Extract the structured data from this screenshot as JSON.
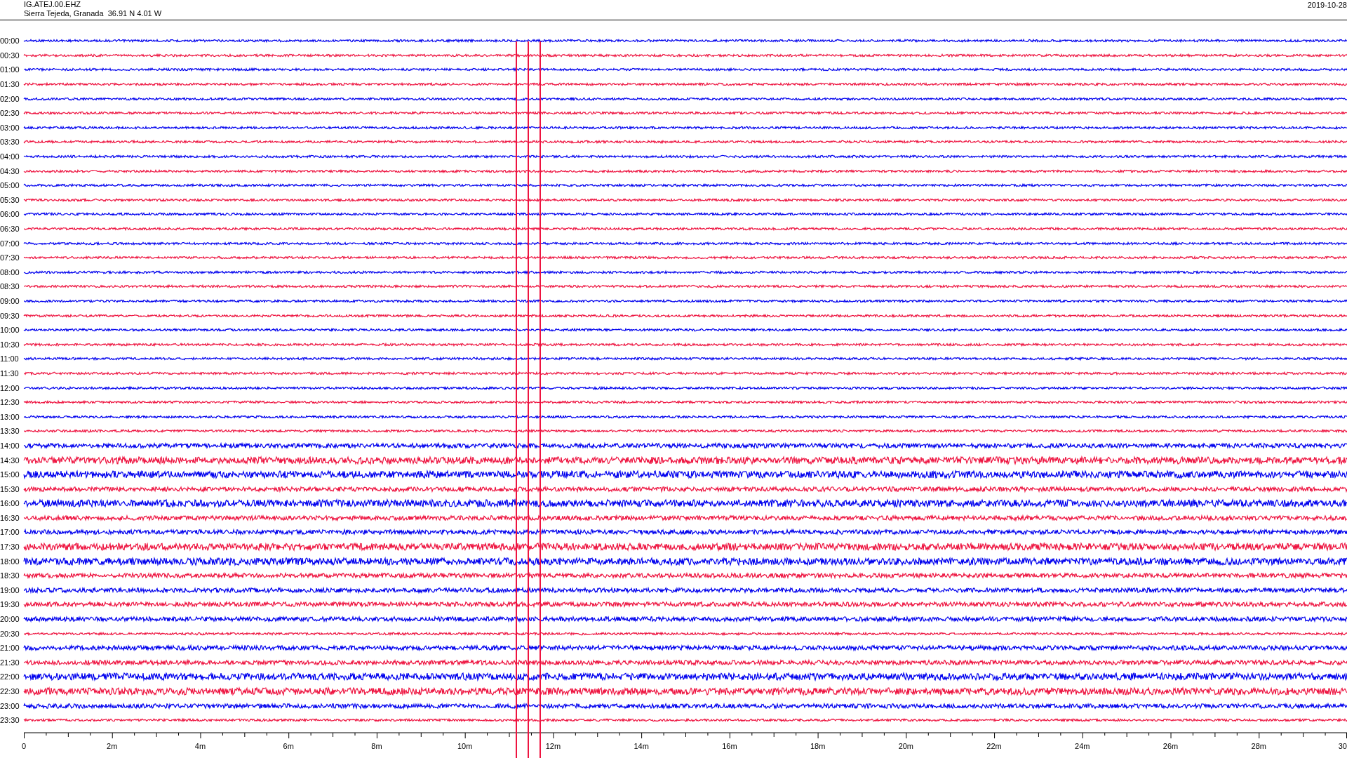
{
  "header": {
    "station": "IG.ATEJ.00.EHZ",
    "location": "Sierra Tejeda, Granada  36.91 N 4.01 W",
    "date": "2019-10-28"
  },
  "traces": [
    {
      "time": "00:00",
      "color": "#0000ee",
      "kind": "quiet"
    },
    {
      "time": "00:30",
      "color": "#ee1440",
      "kind": "quiet"
    },
    {
      "time": "01:00",
      "color": "#0000ee",
      "kind": "quiet"
    },
    {
      "time": "01:30",
      "color": "#ee1440",
      "kind": "quiet"
    },
    {
      "time": "02:00",
      "color": "#0000ee",
      "kind": "quiet"
    },
    {
      "time": "02:30",
      "color": "#ee1440",
      "kind": "quiet"
    },
    {
      "time": "03:00",
      "color": "#0000ee",
      "kind": "quiet"
    },
    {
      "time": "03:30",
      "color": "#ee1440",
      "kind": "quiet"
    },
    {
      "time": "04:00",
      "color": "#0000ee",
      "kind": "quiet"
    },
    {
      "time": "04:30",
      "color": "#ee1440",
      "kind": "quiet"
    },
    {
      "time": "05:00",
      "color": "#0000ee",
      "kind": "quiet"
    },
    {
      "time": "05:30",
      "color": "#ee1440",
      "kind": "quiet"
    },
    {
      "time": "06:00",
      "color": "#0000ee",
      "kind": "quiet"
    },
    {
      "time": "06:30",
      "color": "#ee1440",
      "kind": "quiet"
    },
    {
      "time": "07:00",
      "color": "#0000ee",
      "kind": "quiet"
    },
    {
      "time": "07:30",
      "color": "#ee1440",
      "kind": "quiet"
    },
    {
      "time": "08:00",
      "color": "#0000ee",
      "kind": "quiet"
    },
    {
      "time": "08:30",
      "color": "#ee1440",
      "kind": "quiet"
    },
    {
      "time": "09:00",
      "color": "#0000ee",
      "kind": "quiet"
    },
    {
      "time": "09:30",
      "color": "#ee1440",
      "kind": "quiet"
    },
    {
      "time": "10:00",
      "color": "#0000ee",
      "kind": "quiet"
    },
    {
      "time": "10:30",
      "color": "#ee1440",
      "kind": "quiet"
    },
    {
      "time": "11:00",
      "color": "#0000ee",
      "kind": "quiet"
    },
    {
      "time": "11:30",
      "color": "#ee1440",
      "kind": "quiet"
    },
    {
      "time": "12:00",
      "color": "#0000ee",
      "kind": "quiet"
    },
    {
      "time": "12:30",
      "color": "#ee1440",
      "kind": "quiet"
    },
    {
      "time": "13:00",
      "color": "#0000ee",
      "kind": "quiet"
    },
    {
      "time": "13:30",
      "color": "#ee1440",
      "kind": "quiet"
    },
    {
      "time": "14:00",
      "color": "#0000ee",
      "kind": "noisy"
    },
    {
      "time": "14:30",
      "color": "#ee1440",
      "kind": "loud"
    },
    {
      "time": "15:00",
      "color": "#0000ee",
      "kind": "loud"
    },
    {
      "time": "15:30",
      "color": "#ee1440",
      "kind": "noisy"
    },
    {
      "time": "16:00",
      "color": "#0000ee",
      "kind": "loud"
    },
    {
      "time": "16:30",
      "color": "#ee1440",
      "kind": "noisy"
    },
    {
      "time": "17:00",
      "color": "#0000ee",
      "kind": "noisy"
    },
    {
      "time": "17:30",
      "color": "#ee1440",
      "kind": "loud"
    },
    {
      "time": "18:00",
      "color": "#0000ee",
      "kind": "loud"
    },
    {
      "time": "18:30",
      "color": "#ee1440",
      "kind": "noisy"
    },
    {
      "time": "19:00",
      "color": "#0000ee",
      "kind": "noisy"
    },
    {
      "time": "19:30",
      "color": "#ee1440",
      "kind": "noisy"
    },
    {
      "time": "20:00",
      "color": "#0000ee",
      "kind": "noisy"
    },
    {
      "time": "20:30",
      "color": "#ee1440",
      "kind": "quiet"
    },
    {
      "time": "21:00",
      "color": "#0000ee",
      "kind": "noisy"
    },
    {
      "time": "21:30",
      "color": "#ee1440",
      "kind": "noisy"
    },
    {
      "time": "22:00",
      "color": "#0000ee",
      "kind": "loud"
    },
    {
      "time": "22:30",
      "color": "#ee1440",
      "kind": "loud"
    },
    {
      "time": "23:00",
      "color": "#0000ee",
      "kind": "noisy"
    },
    {
      "time": "23:30",
      "color": "#ee1440",
      "kind": "quiet"
    }
  ],
  "x_axis": {
    "ticks": [
      "0",
      "2m",
      "4m",
      "6m",
      "8m",
      "10m",
      "12m",
      "14m",
      "16m",
      "18m",
      "20m",
      "22m",
      "24m",
      "26m",
      "28m",
      "30"
    ]
  }
}
